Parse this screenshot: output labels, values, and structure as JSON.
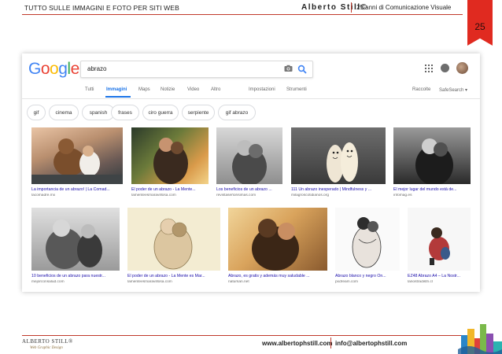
{
  "page_header": {
    "left_title": "TUTTO SULLE IMMAGINI E FOTO PER SITI WEB",
    "brand": "Alberto Still©",
    "right_text": "25 anni di Comunicazione Visuale",
    "page_number": "25"
  },
  "google": {
    "logo_letters": [
      "G",
      "o",
      "o",
      "g",
      "l",
      "e"
    ],
    "logo_colors": [
      "#4285f4",
      "#ea4335",
      "#fbbc05",
      "#4285f4",
      "#34a853",
      "#ea4335"
    ],
    "search": {
      "value": "abrazo"
    },
    "icons": [
      "camera-icon",
      "search-icon",
      "apps-icon",
      "notifications-icon",
      "account-avatar"
    ],
    "tabs": [
      {
        "label": "Tutti",
        "active": false
      },
      {
        "label": "Immagini",
        "active": true
      },
      {
        "label": "Maps",
        "active": false
      },
      {
        "label": "Notizie",
        "active": false
      },
      {
        "label": "Video",
        "active": false
      },
      {
        "label": "Altro",
        "active": false
      },
      {
        "label": "Impostazioni",
        "active": false
      },
      {
        "label": "Strumenti",
        "active": false
      },
      {
        "label": "Raccolte",
        "active": false
      },
      {
        "label": "SafeSearch ▾",
        "active": false
      }
    ],
    "chips": [
      "gif",
      "cinema",
      "spanish",
      "frases",
      "ciro guerra",
      "serpiente",
      "gif abrazo"
    ],
    "results_row1": [
      {
        "title": "La importancia de un abrazo! | La Comad...",
        "source": "lacomadre.mx"
      },
      {
        "title": "El poder de un abrazo - La Mente...",
        "source": "lamenteesmaravillosa.com"
      },
      {
        "title": "Los beneficios de un abrazo ...",
        "source": "revistaseñorisimas.com"
      },
      {
        "title": "111 Un abrazo inesperado | Mindfulness y ...",
        "source": "milagroscotidianos.org"
      },
      {
        "title": "El mejor lugar del mundo está de...",
        "source": "infomag.es"
      }
    ],
    "results_row2": [
      {
        "title": "10 beneficios de un abrazo para nuestr...",
        "source": "mejorconsalud.com"
      },
      {
        "title": "El poder de un abrazo - La Mente es Mar...",
        "source": "lamenteesmaravillosa.com"
      },
      {
        "title": "Abrazo, es gratis y además muy saludable ...",
        "source": "natursan.net"
      },
      {
        "title": "Abrazo blanco y negro On...",
        "source": "pxdream.com"
      },
      {
        "title": "EZ48 Abrazo A4 – La Nostr...",
        "source": "lanostradistri.cl"
      }
    ],
    "accent_color": "#1a73e8"
  },
  "page_footer": {
    "logo_text": "ALBERTO STILL®",
    "logo_tagline": "Web  Graphic  Design",
    "website": "www.albertophstill.com",
    "email": "info@albertophstill.com"
  }
}
